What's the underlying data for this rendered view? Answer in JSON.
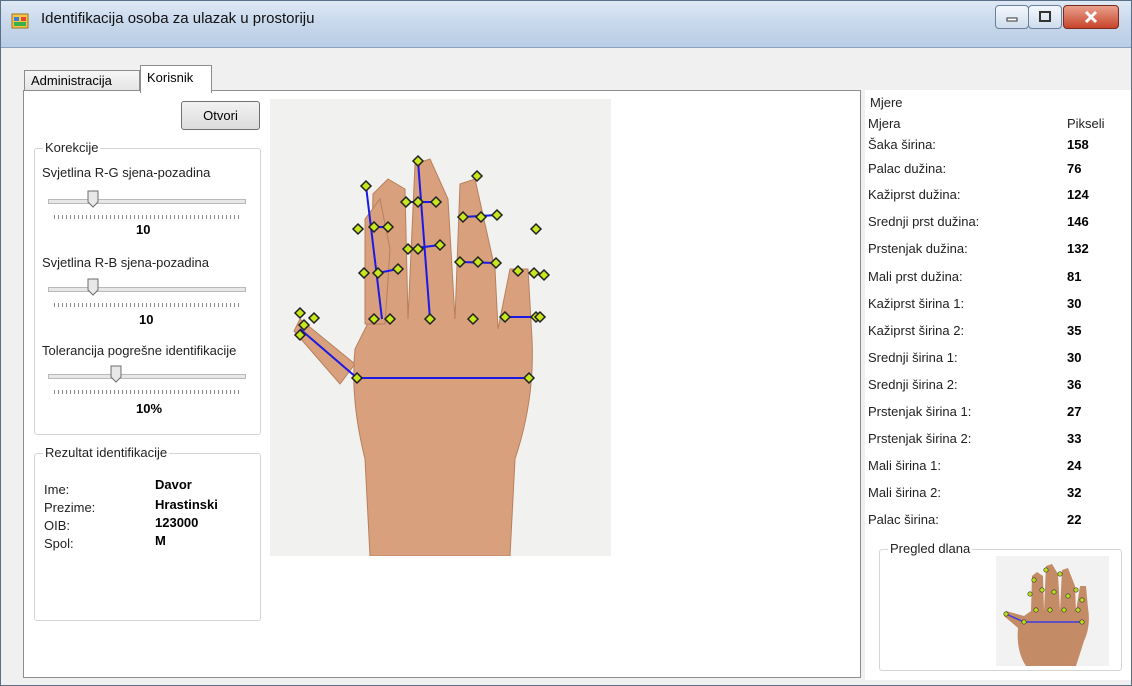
{
  "window": {
    "title": "Identifikacija osoba za ulazak u prostoriju",
    "minimize_icon": "minimize-icon",
    "maximize_icon": "maximize-icon",
    "close_icon": "close-icon"
  },
  "tabs": [
    {
      "label": "Administracija",
      "selected": false
    },
    {
      "label": "Korisnik",
      "selected": true
    }
  ],
  "open_button": "Otvori",
  "corrections": {
    "title": "Korekcije",
    "slider1_label": "Svjetlina R-G sjena-pozadina",
    "slider1_value": "10",
    "slider1_level": 0.25,
    "slider2_label": "Svjetlina R-B sjena-pozadina",
    "slider2_value": "10",
    "slider2_level": 0.25,
    "slider3_label": "Tolerancija pogrešne identifikacije",
    "slider3_value": "10%",
    "slider3_level": 0.35
  },
  "result": {
    "title": "Rezultat identifikacije",
    "rows": [
      {
        "label": "Ime:",
        "value": "Davor"
      },
      {
        "label": "Prezime:",
        "value": "Hrastinski"
      },
      {
        "label": "OIB:",
        "value": "123000"
      },
      {
        "label": "Spol:",
        "value": "M"
      }
    ]
  },
  "measurements": {
    "title": "Mjere",
    "col_measure": "Mjera",
    "col_pixels": "Pikseli",
    "rows": [
      {
        "name": "Šaka širina:",
        "value": "158"
      },
      {
        "name": "Palac dužina:",
        "value": "76"
      },
      {
        "name": "Kažiprst dužina:",
        "value": "124"
      },
      {
        "name": "Srednji prst dužina:",
        "value": "146"
      },
      {
        "name": "Prstenjak dužina:",
        "value": "132"
      },
      {
        "name": "Mali prst dužina:",
        "value": "81"
      },
      {
        "name": "Kažiprst širina 1:",
        "value": "30"
      },
      {
        "name": "Kažiprst širina 2:",
        "value": "35"
      },
      {
        "name": "Srednji širina 1:",
        "value": "30"
      },
      {
        "name": "Srednji širina 2:",
        "value": "36"
      },
      {
        "name": "Prstenjak širina 1:",
        "value": "27"
      },
      {
        "name": "Prstenjak širina 2:",
        "value": "33"
      },
      {
        "name": "Mali širina 1:",
        "value": "24"
      },
      {
        "name": "Mali širina 2:",
        "value": "32"
      },
      {
        "name": "Palac širina:",
        "value": "22"
      }
    ]
  },
  "preview": {
    "title": "Pregled dlana"
  },
  "colors": {
    "marker_fill": "#c8e61e",
    "line": "#1a1ae6",
    "skin": "#d9a07c"
  }
}
